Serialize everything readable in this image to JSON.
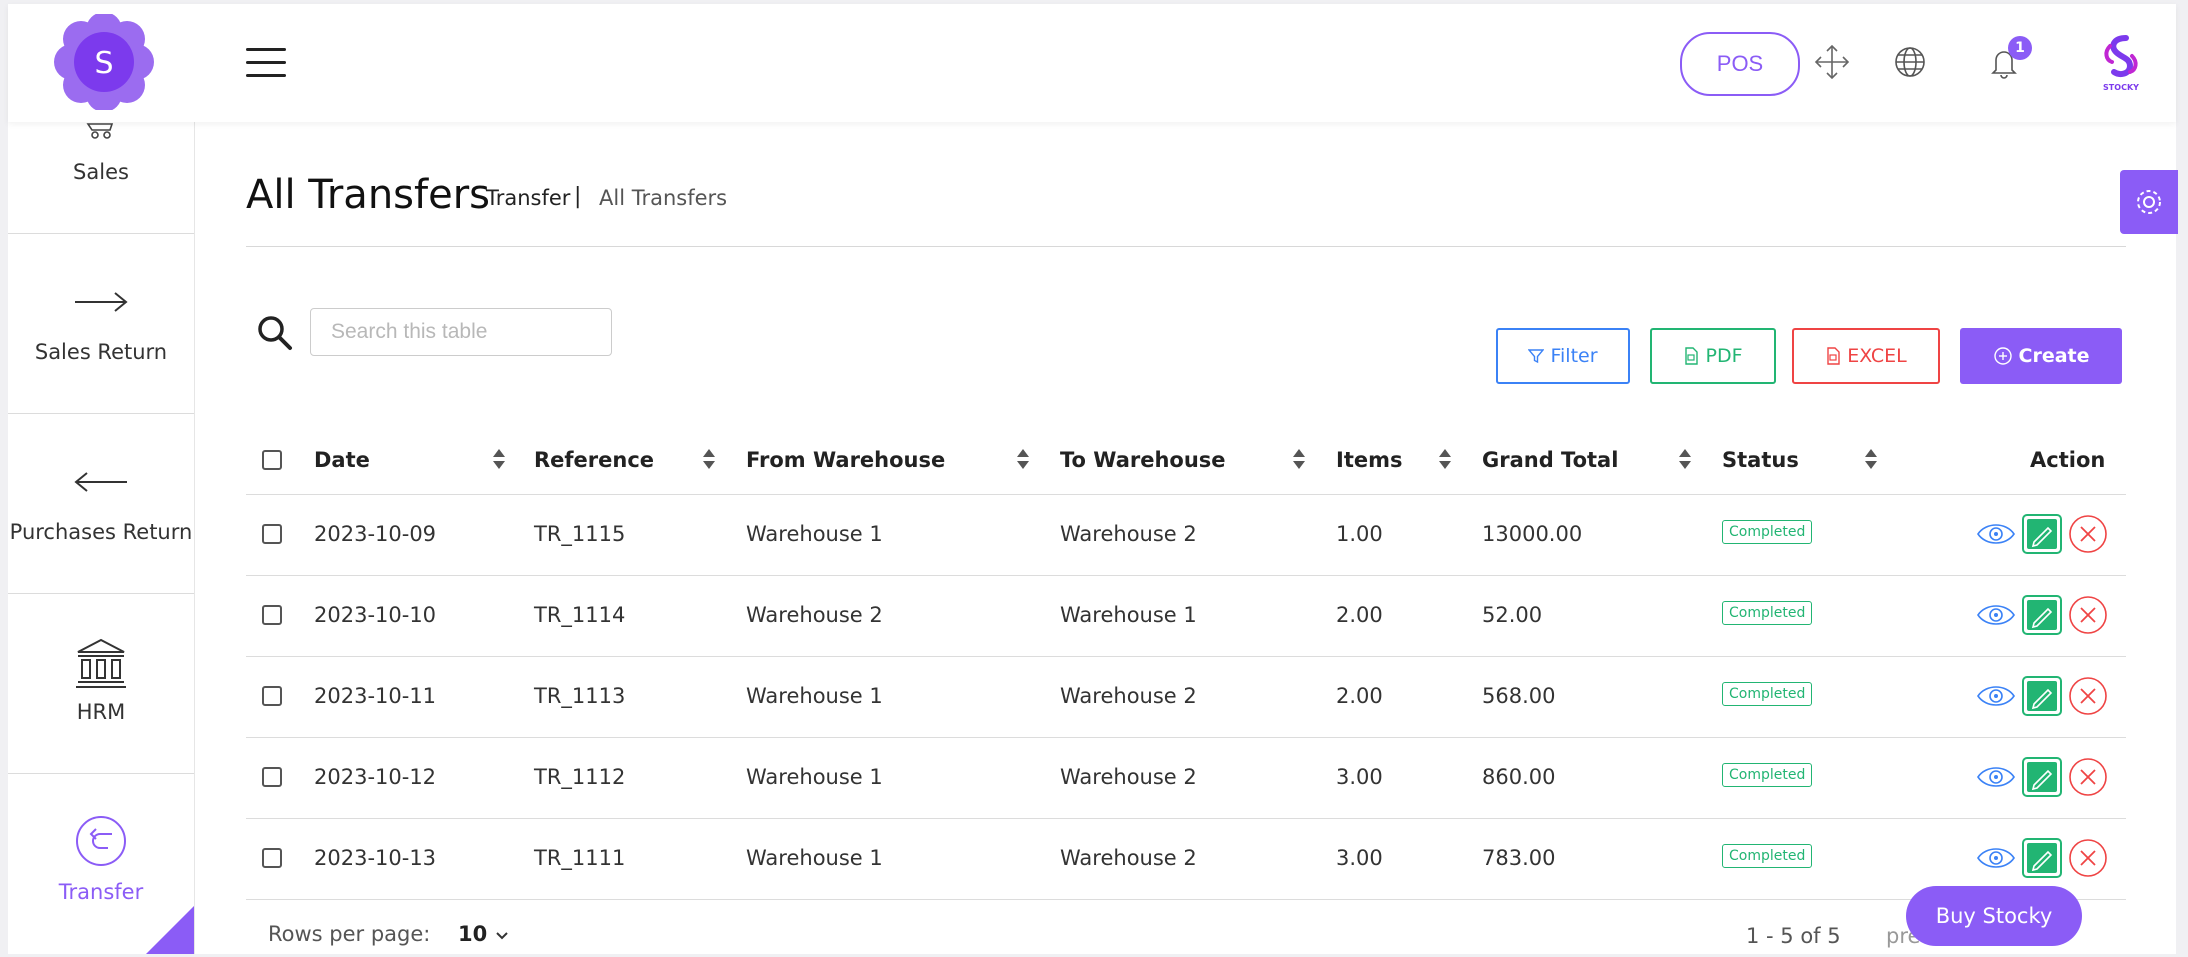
{
  "header": {
    "logo_letter": "S",
    "pos_label": "POS",
    "notification_count": "1",
    "brand_text": "STOCKY"
  },
  "sidebar": {
    "items": [
      {
        "label": "Sales",
        "icon": "cart-icon"
      },
      {
        "label": "Sales Return",
        "icon": "arrow-right-icon"
      },
      {
        "label": "Purchases Return",
        "icon": "arrow-left-icon"
      },
      {
        "label": "HRM",
        "icon": "bank-icon"
      },
      {
        "label": "Transfer",
        "icon": "transfer-icon",
        "active": true
      }
    ]
  },
  "page": {
    "title": "All Transfers",
    "breadcrumb": [
      "Transfer",
      "|",
      "All Transfers"
    ]
  },
  "search": {
    "placeholder": "Search this table"
  },
  "toolbar": {
    "filter_label": "Filter",
    "pdf_label": "PDF",
    "excel_label": "EXCEL",
    "create_label": "Create"
  },
  "table": {
    "columns": [
      "Date",
      "Reference",
      "From Warehouse",
      "To Warehouse",
      "Items",
      "Grand Total",
      "Status",
      "Action"
    ],
    "rows": [
      {
        "date": "2023-10-09",
        "reference": "TR_1115",
        "from": "Warehouse 1",
        "to": "Warehouse 2",
        "items": "1.00",
        "total": "13000.00",
        "status": "Completed"
      },
      {
        "date": "2023-10-10",
        "reference": "TR_1114",
        "from": "Warehouse 2",
        "to": "Warehouse 1",
        "items": "2.00",
        "total": "52.00",
        "status": "Completed"
      },
      {
        "date": "2023-10-11",
        "reference": "TR_1113",
        "from": "Warehouse 1",
        "to": "Warehouse 2",
        "items": "2.00",
        "total": "568.00",
        "status": "Completed"
      },
      {
        "date": "2023-10-12",
        "reference": "TR_1112",
        "from": "Warehouse 1",
        "to": "Warehouse 2",
        "items": "3.00",
        "total": "860.00",
        "status": "Completed"
      },
      {
        "date": "2023-10-13",
        "reference": "TR_1111",
        "from": "Warehouse 1",
        "to": "Warehouse 2",
        "items": "3.00",
        "total": "783.00",
        "status": "Completed"
      }
    ]
  },
  "footer": {
    "rows_per_page_label": "Rows per page:",
    "rows_per_page_value": "10",
    "range": "1 - 5 of 5",
    "pager": "prev   next"
  },
  "buy_label": "Buy Stocky",
  "colors": {
    "accent": "#8b5cf6",
    "success": "#22b573",
    "danger": "#ef4444",
    "info": "#3b82f6"
  }
}
